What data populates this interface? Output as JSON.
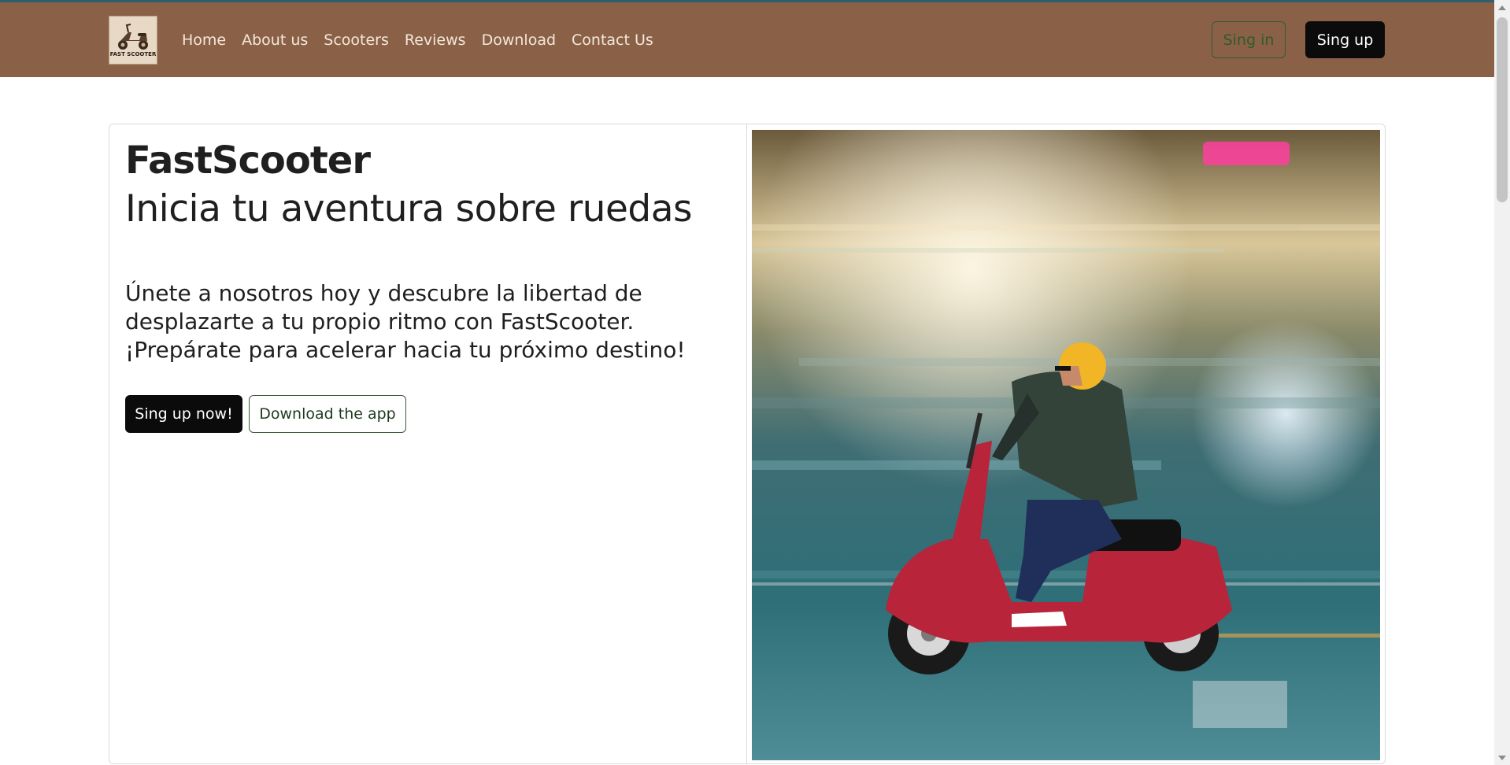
{
  "brand": {
    "logo_text": "FAST SCOOTER"
  },
  "nav": {
    "links": [
      "Home",
      "About us",
      "Scooters",
      "Reviews",
      "Download",
      "Contact Us"
    ],
    "signin_label": "Sing in",
    "signup_label": "Sing up"
  },
  "hero": {
    "title": "FastScooter",
    "subtitle": "Inicia tu aventura sobre ruedas",
    "text": "Únete a nosotros hoy y descubre la libertad de desplazarte a tu propio ritmo con FastScooter. ¡Prepárate para acelerar hacia tu próximo destino!",
    "cta_label": "Sing up now!",
    "download_label": "Download the app"
  },
  "colors": {
    "navbar": "#8a6146",
    "accent_dark": "#0b0b0b",
    "outline_green": "#35563a"
  },
  "icons": {
    "logo": "scooter-logo-icon"
  }
}
